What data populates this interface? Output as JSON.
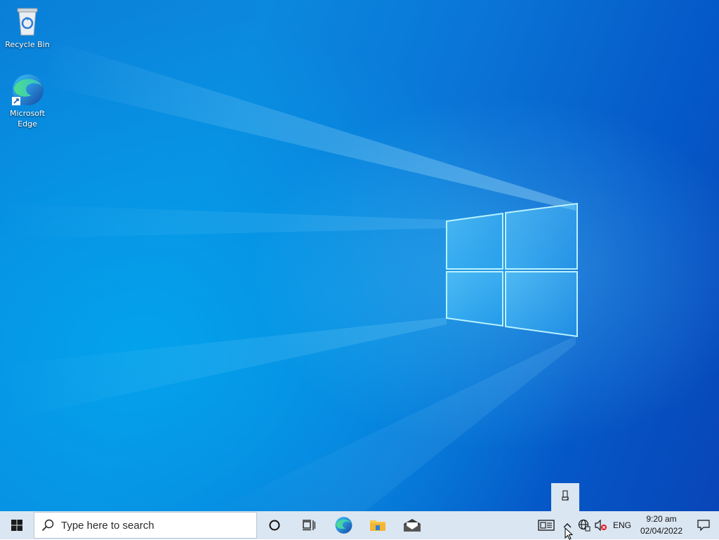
{
  "desktop": {
    "icons": [
      {
        "label": "Recycle Bin",
        "icon": "recycle-bin-icon"
      },
      {
        "label": "Microsoft Edge",
        "icon": "edge-icon"
      }
    ]
  },
  "taskbar": {
    "start_icon": "windows-start-icon",
    "search_placeholder": "Type here to search",
    "search_icon": "search-icon",
    "pinned": [
      {
        "name": "Cortana",
        "icon": "cortana-icon"
      },
      {
        "name": "Task View",
        "icon": "task-view-icon"
      },
      {
        "name": "Microsoft Edge",
        "icon": "edge-icon"
      },
      {
        "name": "File Explorer",
        "icon": "folder-icon"
      },
      {
        "name": "Mail",
        "icon": "mail-icon"
      }
    ]
  },
  "tray": {
    "news_icon": "news-icon",
    "chevron_icon": "chevron-up-icon",
    "network_icon": "globe-icon",
    "volume_icon": "volume-muted-icon",
    "language": "ENG",
    "time": "9:20 am",
    "date": "02/04/2022",
    "notification_icon": "notification-icon",
    "overflow_popup": {
      "icon": "usb-eject-icon"
    }
  },
  "colors": {
    "taskbar_bg": "#dae6f2",
    "desktop_blue": "#0a7fd8",
    "logo_glow": "#9ef0ff"
  }
}
